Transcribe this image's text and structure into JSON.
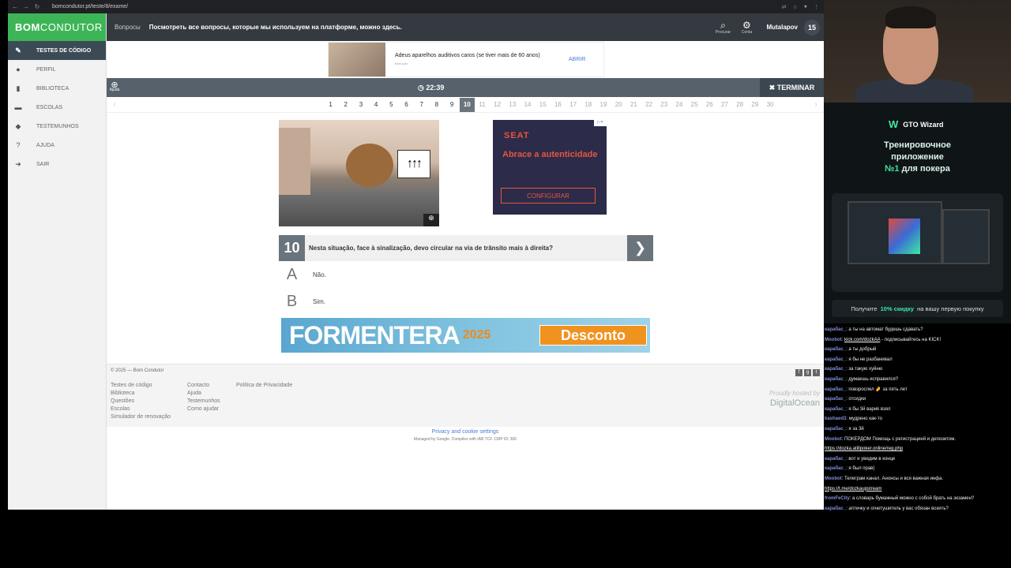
{
  "browser": {
    "url": "bomcondutor.pt/teste/8/exame/"
  },
  "logo": {
    "part1": "BOM",
    "part2": "CONDUTOR"
  },
  "sidebar": {
    "items": [
      {
        "label": "TESTES DE CÓDIGO",
        "icon": "pencil-icon"
      },
      {
        "label": "PERFIL",
        "icon": "user-icon"
      },
      {
        "label": "BIBLIOTECA",
        "icon": "book-icon"
      },
      {
        "label": "ESCOLAS",
        "icon": "car-icon"
      },
      {
        "label": "TESTEMUNHOS",
        "icon": "comments-icon"
      },
      {
        "label": "AJUDA",
        "icon": "question-icon"
      },
      {
        "label": "SAIR",
        "icon": "logout-icon"
      }
    ]
  },
  "topbar": {
    "link": "Вопросы",
    "text": "Посмотреть все вопросы, которые мы используем на платформе, можно здесь.",
    "search_label": "Procurar",
    "account_label": "Conta",
    "user": "Mutalapov",
    "badge": "15"
  },
  "top_ad": {
    "text": "Adeus aparelhos auditivos caros (se tiver mais de 60 anos)",
    "source": "hear.com",
    "button": "ABRIR"
  },
  "exam": {
    "help_label": "Ajuda",
    "timer": "22:39",
    "finish_label": "TERMINAR",
    "pages": [
      "1",
      "2",
      "3",
      "4",
      "5",
      "6",
      "7",
      "8",
      "9",
      "10",
      "11",
      "12",
      "13",
      "14",
      "15",
      "16",
      "17",
      "18",
      "19",
      "20",
      "21",
      "22",
      "23",
      "24",
      "25",
      "26",
      "27",
      "28",
      "29",
      "30"
    ],
    "current_page": 10
  },
  "side_ad": {
    "brand": "SEAT",
    "headline": "Abrace a autenticidade",
    "button": "CONFIGURAR"
  },
  "question": {
    "number": "10",
    "text": "Nesta situação, face à sinalização, devo circular na via de trânsito mais à direita?",
    "options": [
      {
        "letter": "A",
        "text": "Não."
      },
      {
        "letter": "B",
        "text": "Sim."
      }
    ]
  },
  "banner_ad": {
    "title": "FORMENTERA",
    "year": "2025",
    "button": "Desconto"
  },
  "footer": {
    "copyright": "© 2025 — Bom Condutor",
    "col1": [
      "Testes de código",
      "Biblioteca",
      "Questões",
      "Escolas",
      "Simulador de renovação"
    ],
    "col2": [
      "Contacto",
      "Ajuda",
      "Testemunhos",
      "Como ajudar"
    ],
    "col3": [
      "Política de Privacidade"
    ],
    "hosted_line1": "Proudly hosted by",
    "hosted_line2": "DigitalOcean",
    "privacy": "Privacy and cookie settings",
    "managed": "Managed by Google. Complies with IAB TCF. CMP ID: 300"
  },
  "promo": {
    "brand": "GTO Wizard",
    "line1": "Тренировочное",
    "line2": "приложение",
    "line3_num": "№1",
    "line3_rest": " для покера",
    "cta_pre": "Получите",
    "cta_bold": "10% скидку",
    "cta_post": "на вашу первую покупку"
  },
  "chat": [
    {
      "user": "карабас_",
      "text": "а ты на автомат будешь сдавать?"
    },
    {
      "user": "Moobot",
      "text": "kick.com/dozkAA",
      "tail": " - подписывайтесь на KICK!"
    },
    {
      "user": "карабас_",
      "text": "а ты добрый"
    },
    {
      "user": "карабас_",
      "text": "я бы не разбанивал"
    },
    {
      "user": "карабас_",
      "text": "за такую хуйню"
    },
    {
      "user": "карабас_",
      "text": "думаешь исправился?"
    },
    {
      "user": "карабас_",
      "text": "повзрослел 🤌 за пять лет"
    },
    {
      "user": "карабас_",
      "text": "отсидки"
    },
    {
      "user": "карабас_",
      "text": "я бы 3й вариk взял"
    },
    {
      "user": "kashaed3",
      "text": "мудрено как-то"
    },
    {
      "user": "карабас_",
      "text": "я за 3й"
    },
    {
      "user": "Moobot",
      "text": "ПОКЕРДОМ Помощь с регистрацией и депозитом."
    },
    {
      "user": "",
      "text": "https://dozka.atillpoker.online/reg.php"
    },
    {
      "user": "карабас_",
      "text": "вот и увидим в конце"
    },
    {
      "user": "карабас_",
      "text": "я был прав)"
    },
    {
      "user": "Moobot",
      "text": "Телеграм канал. Анонсы и вся важная инфа."
    },
    {
      "user": "",
      "text": "https://t.me/dozkaupstream"
    },
    {
      "user": "fromFeCity",
      "text": "а словарь бумажный можно с собой брать на экзамен?"
    },
    {
      "user": "карабас_",
      "text": "аптечку и огнетушитель у вас обязан возить?"
    }
  ]
}
